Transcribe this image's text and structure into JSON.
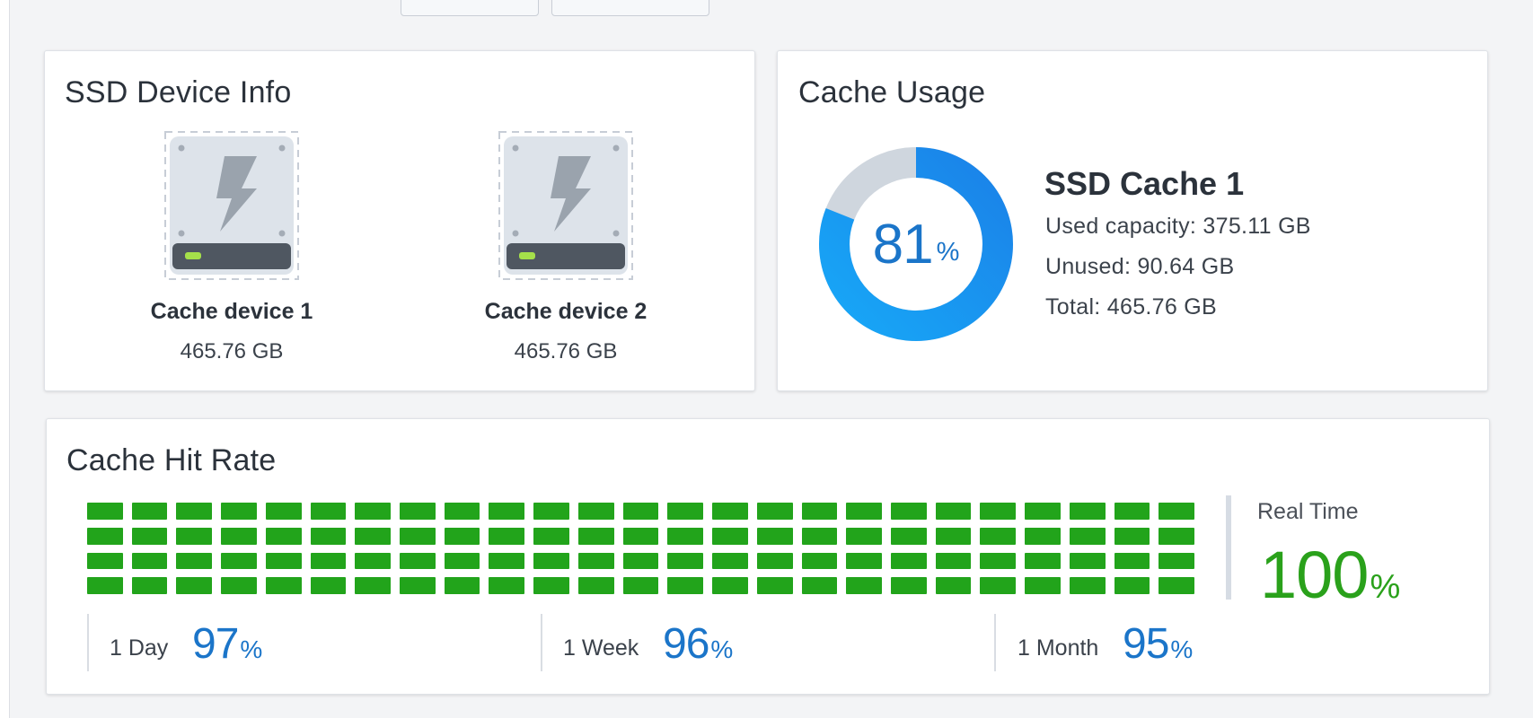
{
  "ssd_info": {
    "title": "SSD Device Info",
    "devices": [
      {
        "name": "Cache device 1",
        "size": "465.76 GB"
      },
      {
        "name": "Cache device 2",
        "size": "465.76 GB"
      }
    ],
    "icon": "ssd-lightning-icon"
  },
  "cache_usage": {
    "title": "Cache Usage",
    "percent": "81",
    "percent_sign": "%",
    "used_fraction": 0.81,
    "name": "SSD Cache 1",
    "used": "Used capacity: 375.11 GB",
    "unused": "Unused: 90.64 GB",
    "total": "Total: 465.76 GB",
    "colors": {
      "used": "#1b8ef2",
      "used_light": "#17a7f7",
      "unused": "#cfd6de"
    }
  },
  "hit_rate": {
    "title": "Cache Hit Rate",
    "realtime_label": "Real Time",
    "realtime_value": "100",
    "realtime_pct": "%",
    "bar_color": "#22a41b",
    "stats": [
      {
        "label": "1 Day",
        "value": "97",
        "pct": "%"
      },
      {
        "label": "1 Week",
        "value": "96",
        "pct": "%"
      },
      {
        "label": "1 Month",
        "value": "95",
        "pct": "%"
      }
    ]
  }
}
